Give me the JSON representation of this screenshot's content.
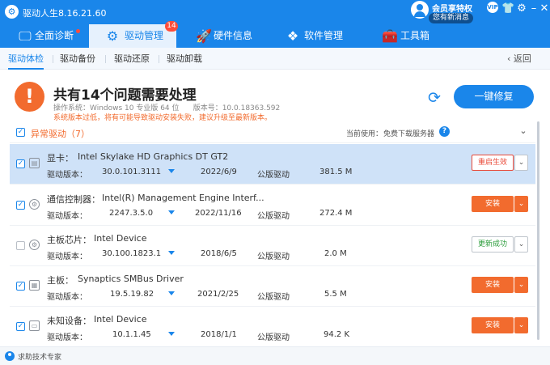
{
  "app": {
    "title": "驱动人生8.16.21.60",
    "vip_label": "会员享特权",
    "message_bubble": "您有新消息",
    "vip_badge": "VIP"
  },
  "top_nav": {
    "tabs": [
      {
        "label": "全面诊断",
        "icon": "monitor-icon"
      },
      {
        "label": "驱动管理",
        "icon": "gear-icon",
        "badge": "14"
      },
      {
        "label": "硬件信息",
        "icon": "rocket-icon"
      },
      {
        "label": "软件管理",
        "icon": "app-grid-icon"
      },
      {
        "label": "工具箱",
        "icon": "toolbox-icon"
      }
    ]
  },
  "sub_nav": {
    "tabs": [
      "驱动体检",
      "驱动备份",
      "驱动还原",
      "驱动卸载"
    ],
    "back_label": "返回"
  },
  "summary": {
    "title": "共有14个问题需要处理",
    "os_line": "操作系统：Windows 10 专业版 64 位      版本号：10.0.18363.592",
    "warning_line": "系统版本过低，将有可能导致驱动安装失败，建议升级至最新版本。",
    "repair_label": "一键修复"
  },
  "list_header": {
    "section_title": "异常驱动（7）",
    "server_label": "当前使用：",
    "server_link": "免费下载服务器"
  },
  "rows": [
    {
      "type": "显卡：",
      "name": "Intel Skylake HD Graphics DT GT2",
      "version_label": "驱动版本：",
      "version": "30.0.101.3111",
      "date": "2022/6/9",
      "publisher": "公版驱动",
      "size": "381.5 M",
      "action": "重启生效",
      "icon": "display-card-icon",
      "checked": true
    },
    {
      "type": "通信控制器：",
      "name": "Intel(R) Management Engine Interf...",
      "version_label": "驱动版本：",
      "version": "2247.3.5.0",
      "date": "2022/11/16",
      "publisher": "公版驱动",
      "size": "272.4 M",
      "action": "安装",
      "icon": "chip-icon",
      "checked": true
    },
    {
      "type": "主板芯片：",
      "name": "Intel Device",
      "version_label": "驱动版本：",
      "version": "30.100.1823.1",
      "date": "2018/6/5",
      "publisher": "公版驱动",
      "size": "2.0 M",
      "action": "更新成功",
      "icon": "chip-icon",
      "checked": false
    },
    {
      "type": "主板：",
      "name": "Synaptics SMBus Driver",
      "version_label": "驱动版本：",
      "version": "19.5.19.82",
      "date": "2021/2/25",
      "publisher": "公版驱动",
      "size": "5.5 M",
      "action": "安装",
      "icon": "motherboard-icon",
      "checked": true
    },
    {
      "type": "未知设备：",
      "name": "Intel Device",
      "version_label": "驱动版本：",
      "version": "10.1.1.45",
      "date": "2018/1/1",
      "publisher": "公版驱动",
      "size": "94.2 K",
      "action": "安装",
      "icon": "monitor-device-icon",
      "checked": true
    }
  ],
  "footer": {
    "support_label": "求助技术专家"
  },
  "colors": {
    "brand_blue": "#1a86ea",
    "warning_orange": "#f26b2e",
    "selected_row": "#cfe2f8",
    "success_green": "#2a9c3a"
  }
}
